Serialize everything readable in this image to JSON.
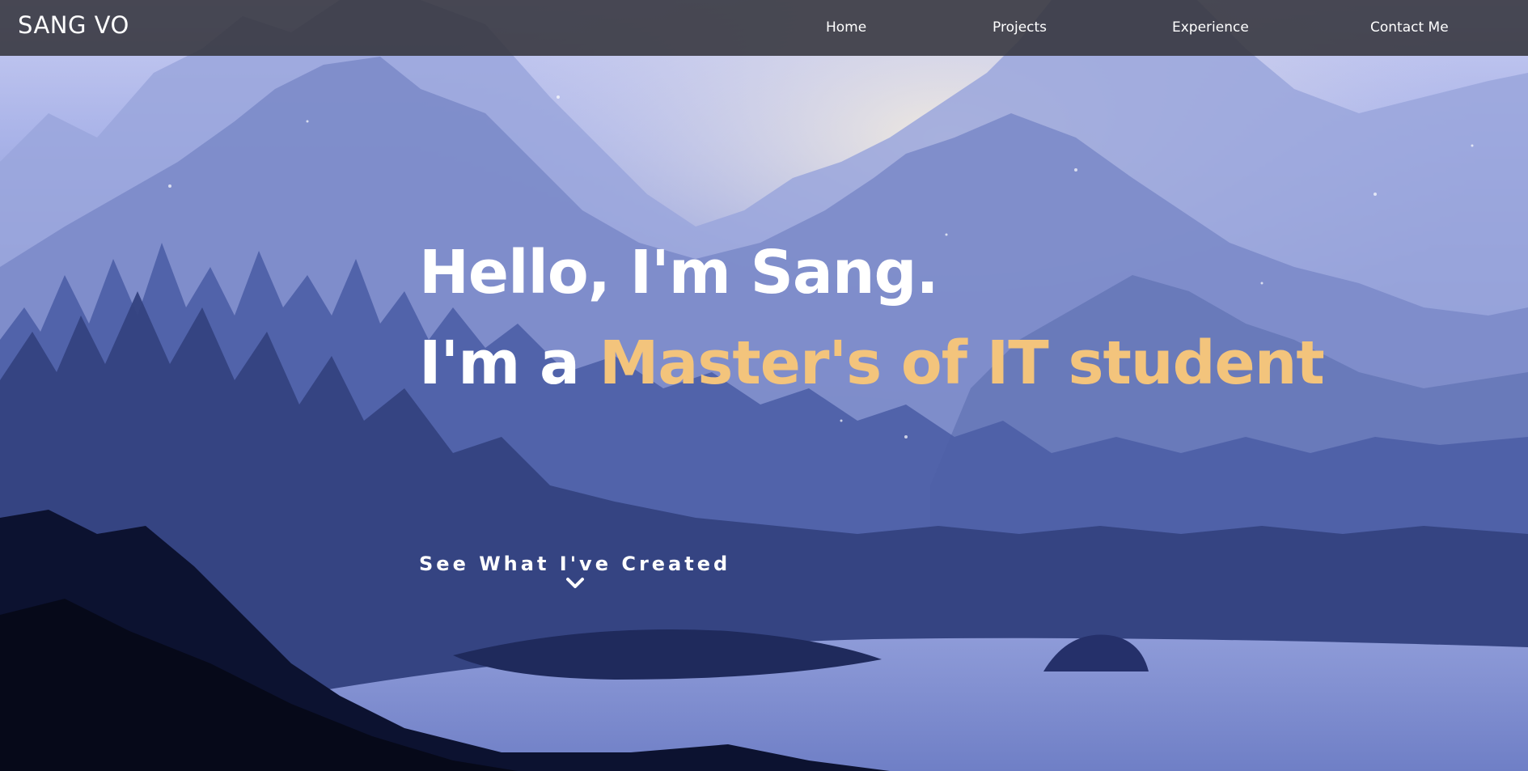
{
  "nav": {
    "brand": "SANG VO",
    "links": [
      {
        "label": "Home"
      },
      {
        "label": "Projects"
      },
      {
        "label": "Experience"
      },
      {
        "label": "Contact Me"
      }
    ]
  },
  "hero": {
    "greeting": "Hello, I'm Sang.",
    "role_prefix": "I'm a ",
    "role": "Master's of IT student",
    "cta_label": "See What I've Created",
    "cta_icon": "chevron-down-icon",
    "background_image": "mountain-forest-lake-landscape"
  },
  "colors": {
    "navbar_bg": "#34343c",
    "accent": "#f3c47c",
    "text": "#ffffff"
  }
}
